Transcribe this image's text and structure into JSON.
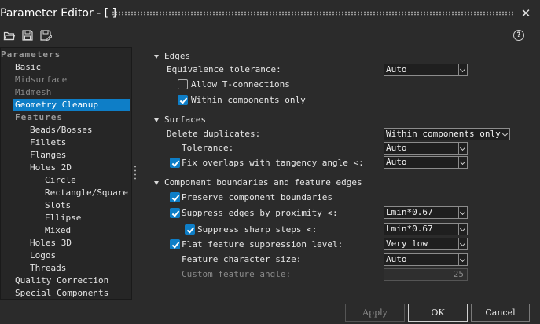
{
  "window": {
    "title": "Parameter Editor - [ ]",
    "close_icon": "close-icon"
  },
  "toolbar": {
    "icons": [
      "open-folder-icon",
      "save-icon",
      "save-as-icon"
    ],
    "help_label": "?"
  },
  "tree": {
    "items": [
      {
        "label": "Parameters",
        "kind": "group"
      },
      {
        "label": "Basic",
        "kind": "item"
      },
      {
        "label": "Midsurface",
        "kind": "dim"
      },
      {
        "label": "Midmesh",
        "kind": "dim"
      },
      {
        "label": "Geometry Cleanup",
        "kind": "selected"
      },
      {
        "label": "Features",
        "kind": "group"
      },
      {
        "label": "Beads/Bosses",
        "kind": "item"
      },
      {
        "label": "Fillets",
        "kind": "item"
      },
      {
        "label": "Flanges",
        "kind": "item"
      },
      {
        "label": "Holes 2D",
        "kind": "item"
      },
      {
        "label": "Circle",
        "kind": "item"
      },
      {
        "label": "Rectangle/Square",
        "kind": "item"
      },
      {
        "label": "Slots",
        "kind": "item"
      },
      {
        "label": "Ellipse",
        "kind": "item"
      },
      {
        "label": "Mixed",
        "kind": "item"
      },
      {
        "label": "Holes 3D",
        "kind": "item"
      },
      {
        "label": "Logos",
        "kind": "item"
      },
      {
        "label": "Threads",
        "kind": "item"
      },
      {
        "label": "Quality Correction",
        "kind": "item"
      },
      {
        "label": "Special Components",
        "kind": "item"
      }
    ]
  },
  "edges": {
    "title": "Edges",
    "equivalence_label": "Equivalence tolerance:",
    "equivalence_value": "Auto",
    "allow_t_label": "Allow T-connections",
    "allow_t_checked": false,
    "within_label": "Within components only",
    "within_checked": true
  },
  "surfaces": {
    "title": "Surfaces",
    "delete_label": "Delete duplicates:",
    "delete_value": "Within components only",
    "tolerance_label": "Tolerance:",
    "tolerance_value": "Auto",
    "fix_label": "Fix overlaps with tangency angle <:",
    "fix_checked": true,
    "fix_value": "Auto"
  },
  "component": {
    "title": "Component boundaries and feature edges",
    "preserve_label": "Preserve component boundaries",
    "preserve_checked": true,
    "suppress_label": "Suppress edges by proximity <:",
    "suppress_checked": true,
    "suppress_value": "Lmin*0.67",
    "sharp_label": "Suppress sharp steps <:",
    "sharp_checked": true,
    "sharp_value": "Lmin*0.67",
    "flat_label": "Flat feature suppression level:",
    "flat_checked": true,
    "flat_value": "Very low",
    "char_label": "Feature character size:",
    "char_value": "Auto",
    "angle_label": "Custom feature angle:",
    "angle_value": "25"
  },
  "buttons": {
    "apply": "Apply",
    "ok": "OK",
    "cancel": "Cancel"
  }
}
